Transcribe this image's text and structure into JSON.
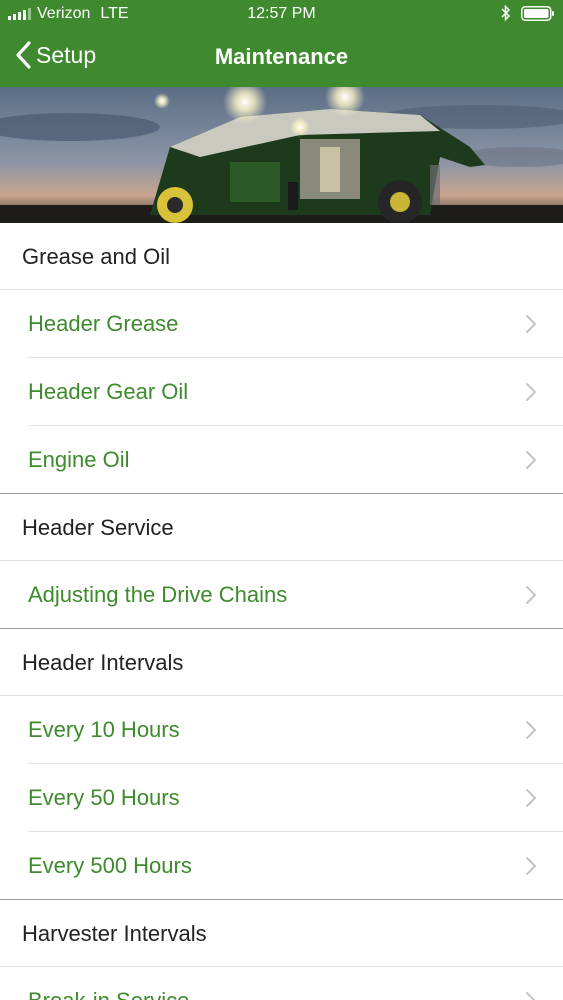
{
  "status_bar": {
    "carrier": "Verizon",
    "network": "LTE",
    "time": "12:57 PM"
  },
  "nav": {
    "back_label": "Setup",
    "title": "Maintenance"
  },
  "colors": {
    "brand_green": "#3f8a2e",
    "link_green": "#3d8b2c"
  },
  "sections": [
    {
      "title": "Grease and Oil",
      "items": [
        "Header Grease",
        "Header Gear Oil",
        "Engine Oil"
      ]
    },
    {
      "title": "Header Service",
      "items": [
        "Adjusting the Drive Chains"
      ]
    },
    {
      "title": "Header Intervals",
      "items": [
        "Every 10 Hours",
        "Every 50 Hours",
        "Every 500 Hours"
      ]
    },
    {
      "title": "Harvester Intervals",
      "items": [
        "Break-in Service"
      ]
    }
  ]
}
